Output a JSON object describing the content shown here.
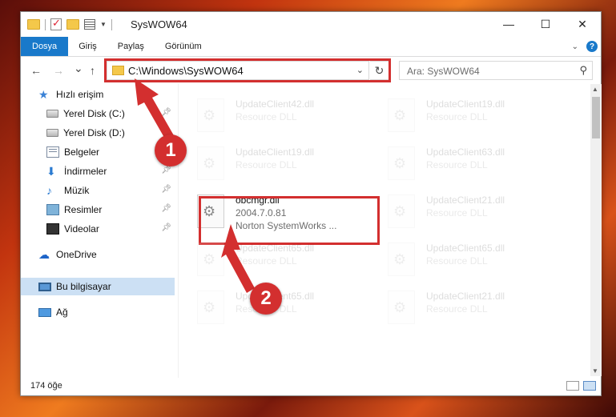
{
  "window": {
    "title": "SysWOW64",
    "controls": {
      "minimize": "—",
      "maximize": "☐",
      "close": "✕"
    }
  },
  "ribbon": {
    "tabs": [
      {
        "label": "Dosya",
        "active": true
      },
      {
        "label": "Giriş"
      },
      {
        "label": "Paylaş"
      },
      {
        "label": "Görünüm"
      }
    ],
    "help": "?"
  },
  "navigation": {
    "back": "←",
    "forward": "→",
    "recent": "⌄",
    "up": "↑",
    "address": "C:\\Windows\\SysWOW64",
    "refresh": "↻",
    "search_placeholder": "Ara: SysWOW64"
  },
  "sidebar": {
    "items": [
      {
        "label": "Hızlı erişim",
        "icon": "star-icon"
      },
      {
        "label": "Yerel Disk (C:)",
        "icon": "drive-icon",
        "pinned": true
      },
      {
        "label": "Yerel Disk (D:)",
        "icon": "drive-icon"
      },
      {
        "label": "Belgeler",
        "icon": "documents-icon"
      },
      {
        "label": "İndirmeler",
        "icon": "downloads-icon",
        "pinned": true
      },
      {
        "label": "Müzik",
        "icon": "music-icon",
        "pinned": true
      },
      {
        "label": "Resimler",
        "icon": "pictures-icon",
        "pinned": true
      },
      {
        "label": "Videolar",
        "icon": "videos-icon",
        "pinned": true
      },
      {
        "label": "OneDrive",
        "icon": "onedrive-icon"
      },
      {
        "label": "Bu bilgisayar",
        "icon": "this-pc-icon",
        "selected": true
      },
      {
        "label": "Ağ",
        "icon": "network-icon"
      }
    ]
  },
  "files": [
    {
      "name": "UpdateClient42.dll",
      "desc": "Resource DLL"
    },
    {
      "name": "UpdateClient19.dll",
      "desc": "Resource DLL"
    },
    {
      "name": "UpdateClient19.dll",
      "desc": "Resource DLL"
    },
    {
      "name": "UpdateClient63.dll",
      "desc": "Resource DLL"
    },
    {
      "name": "obcmgr.dll",
      "version": "2004.7.0.81",
      "company": "Norton SystemWorks ...",
      "highlighted": true
    },
    {
      "name": "UpdateClient21.dll",
      "desc": "Resource DLL"
    },
    {
      "name": "UpdateClient65.dll",
      "desc": "Resource DLL"
    },
    {
      "name": "UpdateClient65.dll",
      "desc": "Resource DLL"
    },
    {
      "name": "UpdateClient65.dll",
      "desc": "Resource DLL"
    },
    {
      "name": "UpdateClient21.dll",
      "desc": "Resource DLL"
    }
  ],
  "status": {
    "item_count": "174 öğe"
  },
  "annotations": {
    "step1": "1",
    "step2": "2",
    "color": "#d32f2f"
  }
}
